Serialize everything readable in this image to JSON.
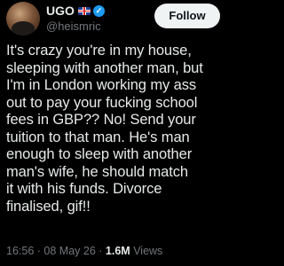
{
  "author": {
    "name": "UGO",
    "handle": "@heismric",
    "flag": "uk-flag-icon",
    "verified_icon": "verified-badge-icon",
    "verified_color": "#1d9bf0"
  },
  "follow_button": {
    "label": "Follow"
  },
  "tweet": {
    "lines": [
      "It's crazy you're in my house,",
      "sleeping with another man, but",
      "I'm in London working my ass",
      "out to pay your fucking school",
      "fees in GBP?? No! Send your",
      "tuition to that man. He's man",
      "enough to sleep with another",
      "man's wife, he should match",
      "it with his funds. Divorce",
      "finalised, gif!!"
    ]
  },
  "meta": {
    "time": "16:56",
    "date": "08 May 26",
    "views_count": "1.6M",
    "views_label": "Views"
  },
  "colors": {
    "background": "#000000",
    "text": "#e7e9ea",
    "muted": "#71767b",
    "button_bg": "#eff3f4"
  }
}
